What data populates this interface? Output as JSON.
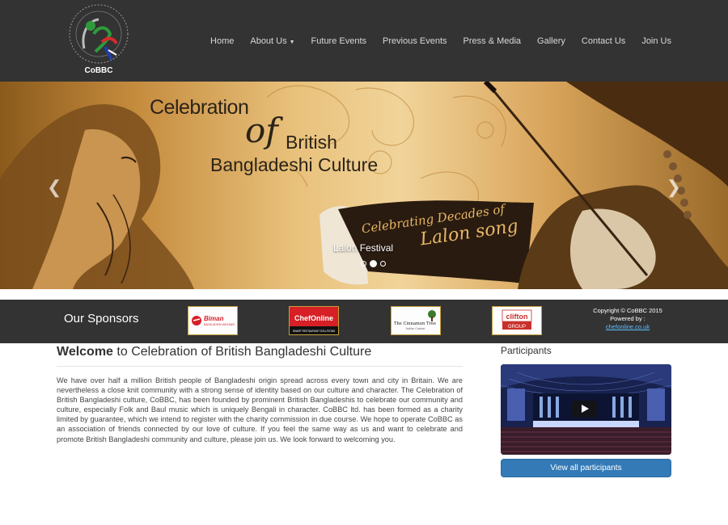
{
  "brand": {
    "logo_text": "CoBBC",
    "logo_ring_text": "Celebration of British Bangladeshi Culture"
  },
  "nav": {
    "items": [
      {
        "label": "Home"
      },
      {
        "label": "About Us",
        "has_dropdown": true
      },
      {
        "label": "Future Events"
      },
      {
        "label": "Previous Events"
      },
      {
        "label": "Press & Media"
      },
      {
        "label": "Gallery"
      },
      {
        "label": "Contact Us"
      },
      {
        "label": "Join Us"
      }
    ]
  },
  "hero": {
    "title_line1": "Celebration",
    "title_of": "of",
    "title_line2": "British",
    "title_line3": "Bangladeshi Culture",
    "ribbon_line1": "Celebrating Decades of",
    "ribbon_line2": "Lalon song",
    "caption": "Lalon Festival",
    "slide_count": 3,
    "active_slide": 2
  },
  "sponsors": {
    "title": "Our Sponsors",
    "items": [
      {
        "name": "Biman",
        "subtitle": "BANGLADESH AIRLINES"
      },
      {
        "name": "ChefOnline",
        "subtitle": "SMART RESTAURANT SOLUTIONS"
      },
      {
        "name": "The Cinnamon Tree",
        "subtitle": "Indian Cuisine"
      },
      {
        "name": "clifton",
        "subtitle": "GROUP"
      }
    ],
    "copyright": "Copyright © CoBBC 2015",
    "powered_by": "Powered by :",
    "powered_link": "chefonline.co.uk"
  },
  "welcome": {
    "title_bold": "Welcome",
    "title_rest": " to Celebration of British Bangladeshi Culture",
    "body": "We have over half a million British people of Bangladeshi origin spread across every town and city in Britain. We are nevertheless a close knit community with a strong sense of identity based on our culture and character. The Celebration of British Bangladeshi culture, CoBBC, has been founded by prominent British Bangladeshis to celebrate our community and culture, especially Folk and Baul music which is uniquely Bengali in character. CoBBC ltd. has been formed as a charity limited by guarantee, which we intend to register with the charity commission in due course. We hope to operate CoBBC as an association of friends connected by our love of culture. If you feel the same way as us and want to celebrate and promote British Bangladeshi community  and culture, please join us. We look  forward to welcoming you."
  },
  "participants": {
    "title": "Participants",
    "button_label": "View all participants"
  },
  "colors": {
    "navbar": "#333333",
    "button": "#337ab7",
    "link": "#5bc0ff"
  }
}
